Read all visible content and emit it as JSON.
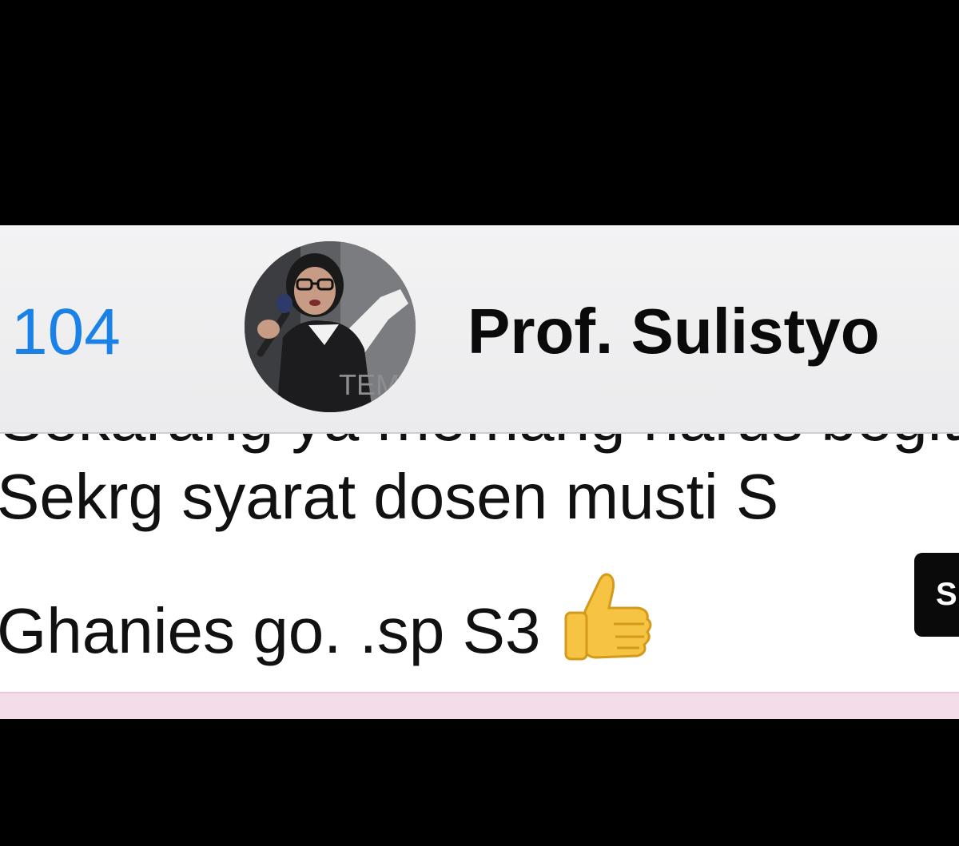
{
  "header": {
    "back_count": "104",
    "contact_name": "Prof. Sulistyo",
    "avatar_watermark": "TEM"
  },
  "message": {
    "clipped_top_line": "Sekarang ya memang harus begitu juga ya",
    "line1": "Sekrg syarat dosen musti S",
    "line2": "Ghanies go. .sp S3",
    "emoji": "thumbs-up-icon"
  },
  "side_chip": {
    "label": "S"
  },
  "colors": {
    "accent": "#1a82e6",
    "header_bg": "#f0f0f2",
    "strip_pink": "#f2dde9"
  }
}
